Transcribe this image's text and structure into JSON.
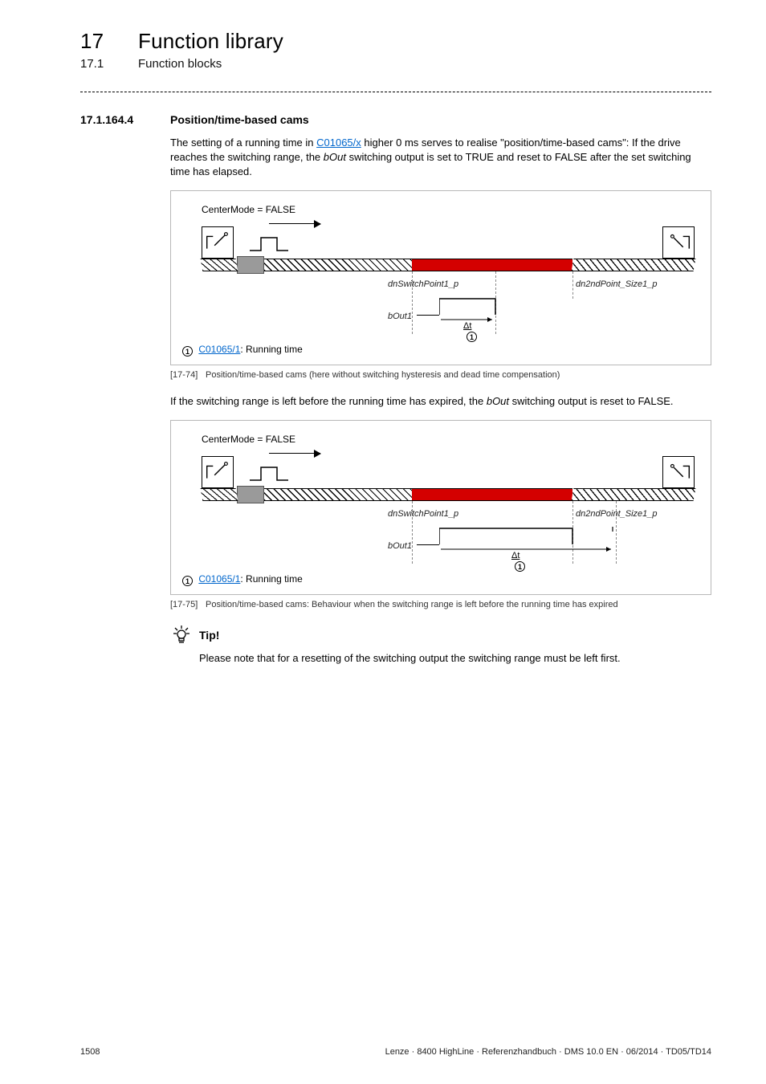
{
  "header": {
    "chapter_num": "17",
    "chapter_title": "Function library",
    "sub_num": "17.1",
    "sub_title": "Function blocks"
  },
  "section": {
    "num": "17.1.164.4",
    "title": "Position/time-based cams"
  },
  "intro": {
    "pre": "The setting of a running time in ",
    "link": "C01065/x",
    "mid": " higher 0 ms serves to realise \"position/time-based cams\": If the drive reaches the switching range, the ",
    "italic": "bOut",
    "post": " switching output is set to TRUE and reset to FALSE after the set switching time has elapsed."
  },
  "fig1": {
    "mode": "CenterMode = FALSE",
    "pt1": "dnSwitchPoint1_p",
    "pt2": "dn2ndPoint_Size1_p",
    "bout": "bOut1",
    "dt": "Δt",
    "marker": "1",
    "legend_link": "C01065/1",
    "legend_text": ": Running time"
  },
  "caption1": {
    "num": "[17-74]",
    "text": "Position/time-based cams (here without switching hysteresis and dead time compensation)"
  },
  "mid": {
    "pre": "If the switching range is left before the running time has expired, the ",
    "italic": "bOut",
    "post": " switching output is reset to FALSE."
  },
  "fig2": {
    "mode": "CenterMode = FALSE",
    "pt1": "dnSwitchPoint1_p",
    "pt2": "dn2ndPoint_Size1_p",
    "bout": "bOut1",
    "dt": "Δt",
    "marker": "1",
    "legend_link": "C01065/1",
    "legend_text": ": Running time"
  },
  "caption2": {
    "num": "[17-75]",
    "text": "Position/time-based cams: Behaviour when the switching range is left before the running time has expired"
  },
  "tip": {
    "label": "Tip!",
    "body": "Please note that for a resetting of the switching output the switching range must be left first."
  },
  "footer": {
    "page": "1508",
    "info": "Lenze · 8400 HighLine · Referenzhandbuch · DMS 10.0 EN · 06/2014 · TD05/TD14"
  }
}
